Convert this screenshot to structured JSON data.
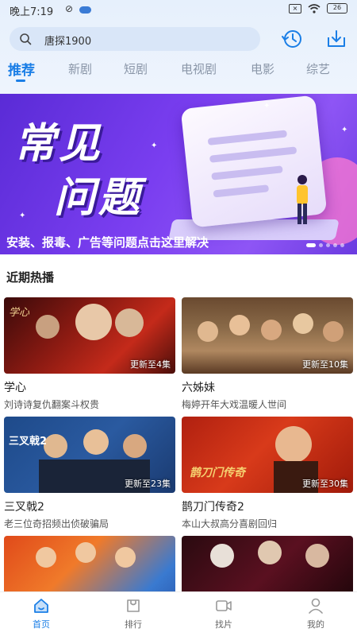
{
  "status_bar": {
    "time": "晚上7:19",
    "battery": "26"
  },
  "search": {
    "query": "唐探1900"
  },
  "tabs": [
    {
      "label": "推荐",
      "active": true
    },
    {
      "label": "新剧"
    },
    {
      "label": "短剧"
    },
    {
      "label": "电视剧"
    },
    {
      "label": "电影"
    },
    {
      "label": "综艺"
    }
  ],
  "banner": {
    "title_line1": "常见",
    "title_line2": "问题",
    "caption": "安装、报毒、广告等问题点击这里解决"
  },
  "section": {
    "title": "近期热播"
  },
  "cards": [
    {
      "title": "学心",
      "desc": "刘诗诗复仇翻案斗权贵",
      "badge": "更新至4集",
      "overlay": "学心"
    },
    {
      "title": "六姊妹",
      "desc": "梅婷开年大戏温暖人世间",
      "badge": "更新至10集",
      "overlay": ""
    },
    {
      "title": "三叉戟2",
      "desc": "老三位奇招频出侦破骗局",
      "badge": "更新至23集",
      "overlay": "三叉戟2"
    },
    {
      "title": "鹊刀门传奇2",
      "desc": "本山大叔高分喜剧回归",
      "badge": "更新至30集",
      "overlay": "鹊刀门传奇"
    },
    {
      "title": "",
      "desc": "",
      "badge": "",
      "overlay": ""
    },
    {
      "title": "",
      "desc": "",
      "badge": "",
      "overlay": ""
    }
  ],
  "bottom_nav": [
    {
      "label": "首页",
      "icon": "home-icon",
      "active": true
    },
    {
      "label": "排行",
      "icon": "ranking-icon"
    },
    {
      "label": "找片",
      "icon": "video-icon"
    },
    {
      "label": "我的",
      "icon": "profile-icon"
    }
  ],
  "colors": {
    "accent": "#1a7ee6",
    "banner_purple": "#7a3ef0",
    "nav_inactive": "#666666"
  }
}
